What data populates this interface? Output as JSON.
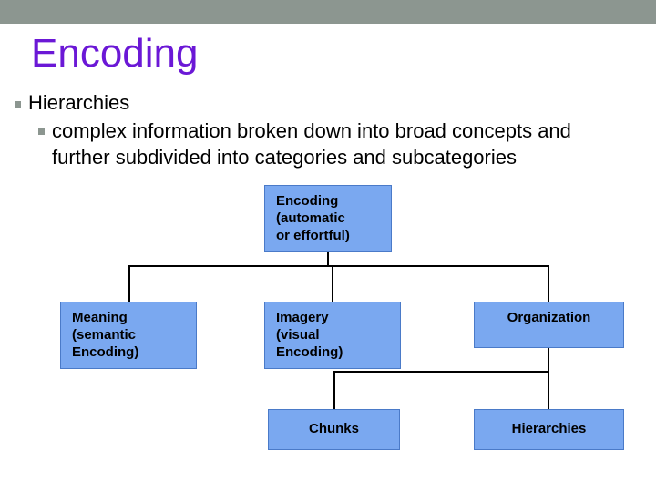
{
  "title": "Encoding",
  "bullet1": "Hierarchies",
  "bullet2": "complex information broken down into broad concepts and further subdivided into categories and subcategories",
  "nodes": {
    "top": "Encoding\n(automatic\nor effortful)",
    "l1a": "Meaning\n(semantic\nEncoding)",
    "l1b": "Imagery\n(visual\nEncoding)",
    "l1c": "Organization",
    "l2a": "Chunks",
    "l2b": "Hierarchies"
  },
  "colors": {
    "topbar": "#8c9690",
    "title": "#6b18d6",
    "node_fill": "#7aa8f0",
    "node_border": "#4a7ac8"
  }
}
